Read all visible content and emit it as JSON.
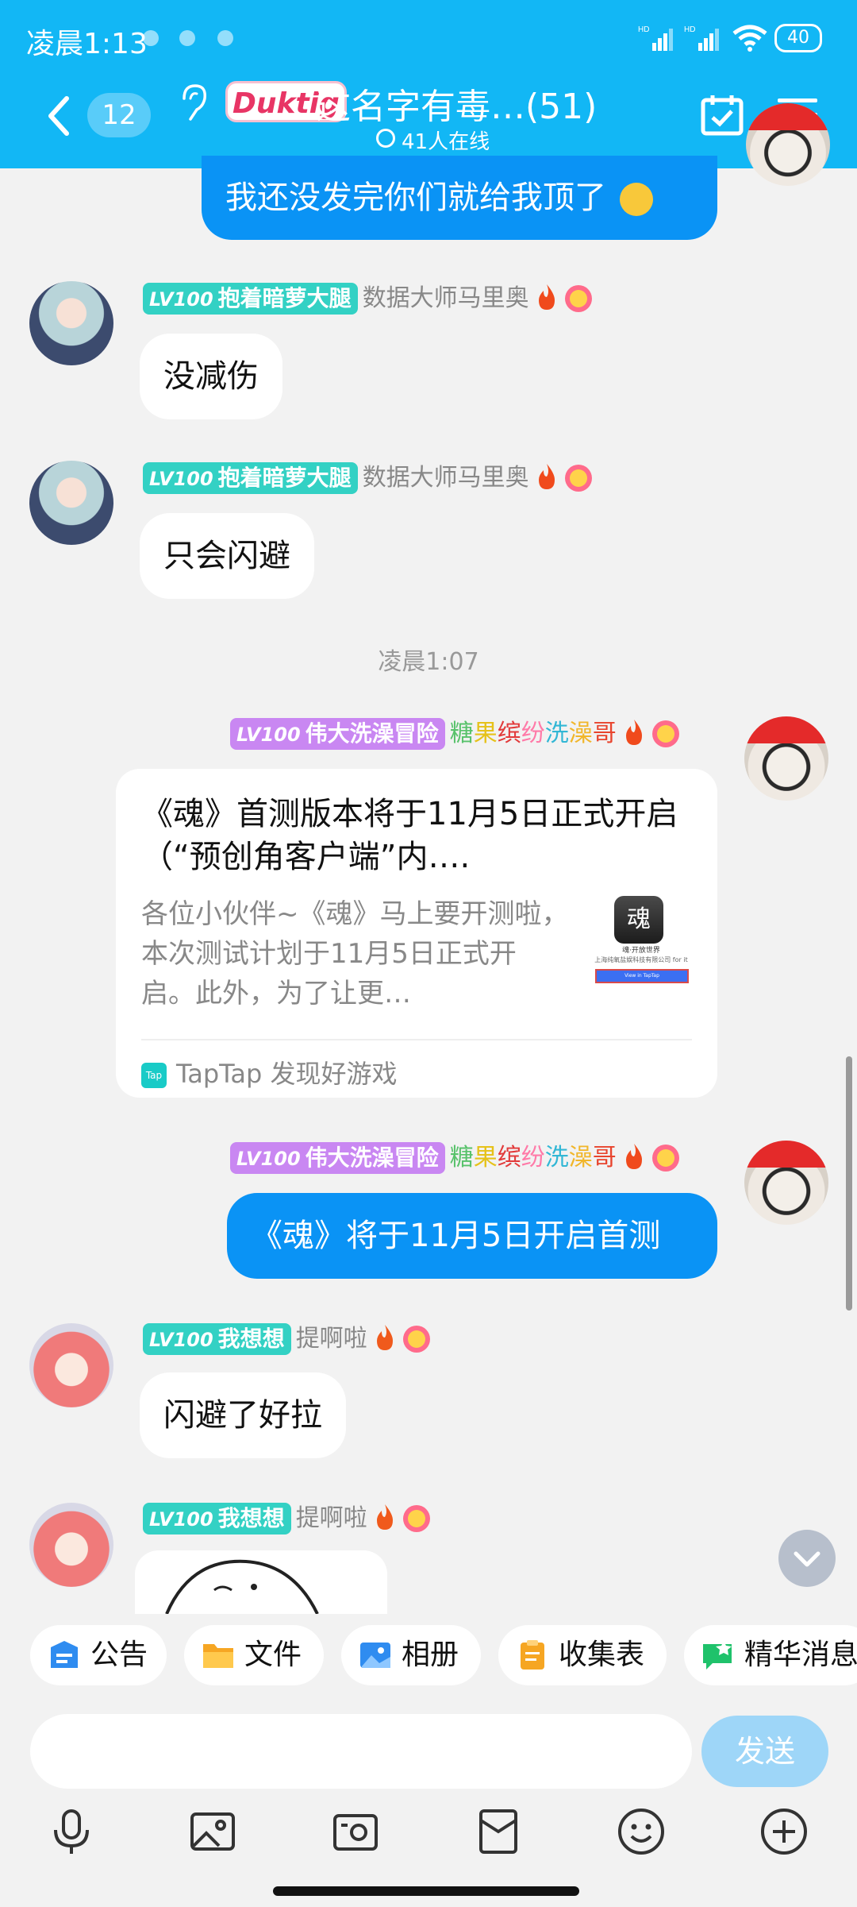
{
  "status_bar": {
    "time": "凌晨1:13",
    "battery": "40"
  },
  "header": {
    "back_count": "12",
    "group_logo": "Duktig",
    "group_title": "这名字有毒…(51)",
    "online": "41人在线"
  },
  "messages": {
    "m0": {
      "text": "我还没发完你们就给我顶了"
    },
    "m1": {
      "level": "LV100",
      "title": "抱着暗萝大腿",
      "nick": "数据大师马里奥",
      "text": "没减伤"
    },
    "m2": {
      "level": "LV100",
      "title": "抱着暗萝大腿",
      "nick": "数据大师马里奥",
      "text": "只会闪避"
    },
    "timestamp": "凌晨1:07",
    "m3": {
      "level": "LV100",
      "title": "伟大洗澡冒险",
      "nick_chars": [
        "糖",
        "果",
        "缤",
        "纷",
        "洗",
        "澡",
        "哥"
      ],
      "card_title": "《魂》首测版本将于11月5日正式开启（“预创角客户端”内….",
      "card_desc": "各位小伙伴~《魂》马上要开测啦，本次测试计划于11月5日正式开启。此外，为了让更…",
      "card_source": "TapTap 发现好游戏",
      "thumb_text": "魂",
      "thumb_caption": "魂·开放世界",
      "thumb_company": "上海纯氧盐娱科技有限公司 for it",
      "thumb_button": "View in TapTap"
    },
    "m4": {
      "level": "LV100",
      "title": "伟大洗澡冒险",
      "nick_chars": [
        "糖",
        "果",
        "缤",
        "纷",
        "洗",
        "澡",
        "哥"
      ],
      "text": "《魂》将于11月5日开启首测"
    },
    "m5": {
      "level": "LV100",
      "title": "我想想",
      "nick": "提啊啦",
      "text": "闪避了好拉"
    },
    "m6": {
      "level": "LV100",
      "title": "我想想",
      "nick": "提啊啦"
    }
  },
  "nick_colors": [
    "#58c26b",
    "#e6c21a",
    "#e23b3b",
    "#ff7aa8",
    "#32b7d5",
    "#f1b62a",
    "#e8442d"
  ],
  "toolbar": {
    "chips": [
      "公告",
      "文件",
      "相册",
      "收集表",
      "精华消息"
    ]
  },
  "input": {
    "placeholder": "",
    "send_label": "发送"
  },
  "bottom_icons": [
    "microphone-icon",
    "image-icon",
    "camera-icon",
    "red-packet-icon",
    "emoji-icon",
    "plus-icon"
  ]
}
